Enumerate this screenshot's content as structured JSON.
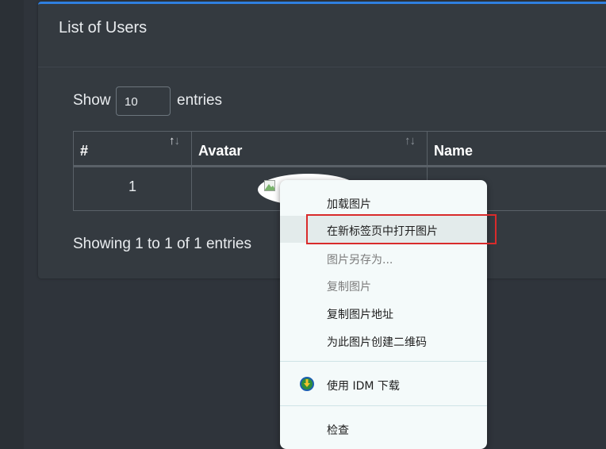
{
  "card": {
    "title": "List of Users"
  },
  "length": {
    "show": "Show",
    "value": "10",
    "entries": "entries"
  },
  "table": {
    "headers": [
      "#",
      "Avatar",
      "Name"
    ],
    "rows": [
      {
        "num": "1"
      }
    ]
  },
  "info": "Showing 1 to 1 of 1 entries",
  "context_menu": {
    "items": [
      "加载图片",
      "在新标签页中打开图片",
      "图片另存为...",
      "复制图片",
      "复制图片地址",
      "为此图片创建二维码",
      "使用 IDM 下载",
      "检查"
    ]
  },
  "colors": {
    "accent": "#2f7fe0",
    "highlight": "#d92b2b",
    "background": "#2f343b"
  }
}
